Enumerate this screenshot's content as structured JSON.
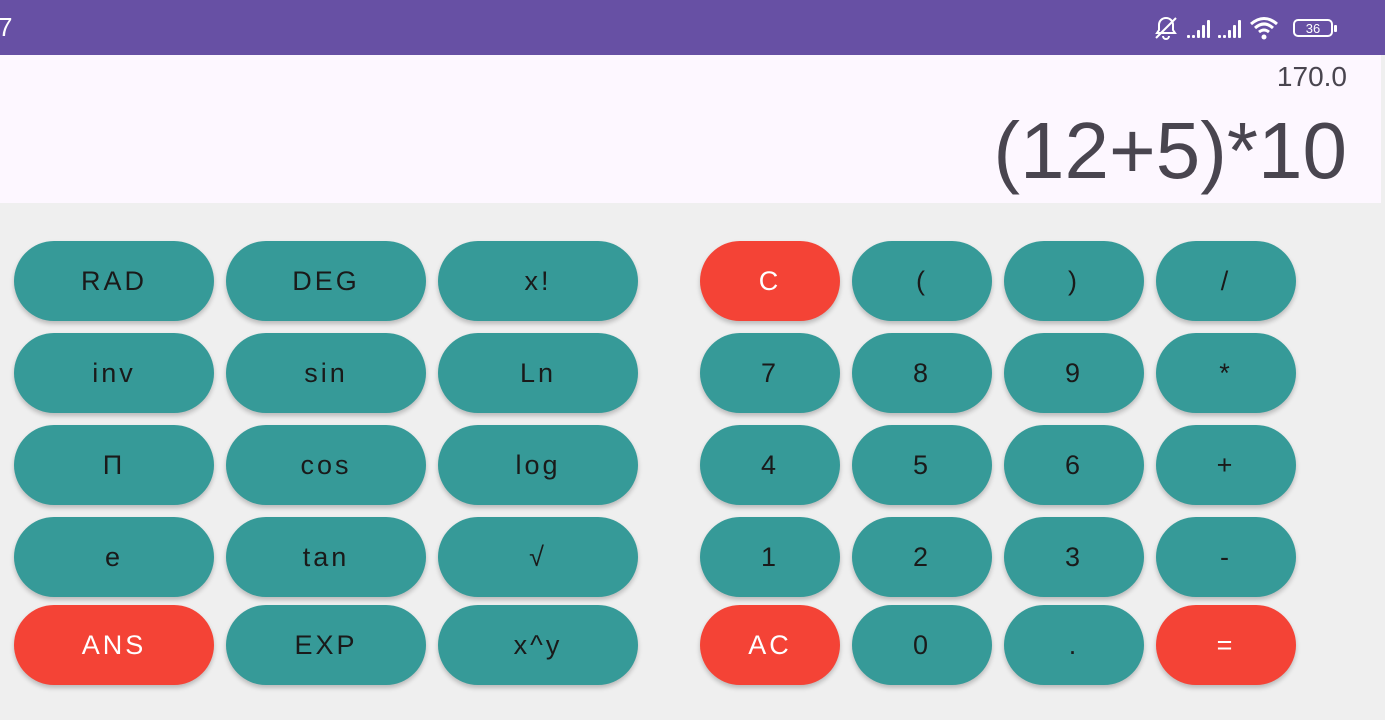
{
  "status_bar": {
    "time": "7",
    "battery": "36",
    "icons": [
      "mute-icon",
      "signal-icon",
      "signal-icon",
      "wifi-icon",
      "battery-icon"
    ]
  },
  "display": {
    "result": "170.0",
    "expression": "(12+5)*10"
  },
  "scientific_keys": [
    [
      "RAD",
      "DEG",
      "x!"
    ],
    [
      "inv",
      "sin",
      "Ln"
    ],
    [
      "Π",
      "cos",
      "log"
    ],
    [
      "e",
      "tan",
      "√"
    ],
    [
      "ANS",
      "EXP",
      "x^y"
    ]
  ],
  "number_keys": [
    [
      "C",
      "(",
      ")",
      "/"
    ],
    [
      "7",
      "8",
      "9",
      "*"
    ],
    [
      "4",
      "5",
      "6",
      "+"
    ],
    [
      "1",
      "2",
      "3",
      "-"
    ],
    [
      "AC",
      "0",
      ".",
      "="
    ]
  ],
  "colors": {
    "status_bar": "#6750a4",
    "button": "#369a98",
    "accent_button": "#f44336",
    "display_bg": "#fdf7ff",
    "pad_bg": "#efefef"
  }
}
